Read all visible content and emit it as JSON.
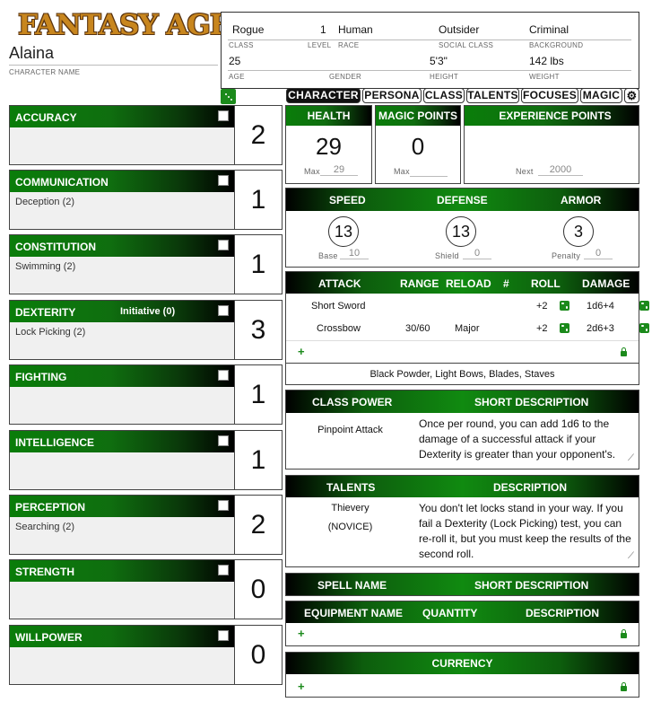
{
  "logo": "FANTASY AGE",
  "character": {
    "name": "Alaina",
    "name_label": "CHARACTER NAME"
  },
  "header": {
    "class": "Rogue",
    "class_label": "CLASS",
    "level": "1",
    "level_label": "LEVEL",
    "race": "Human",
    "race_label": "RACE",
    "social_class": "Outsider",
    "social_class_label": "SOCIAL CLASS",
    "background": "Criminal",
    "background_label": "BACKGROUND",
    "age": "25",
    "age_label": "AGE",
    "gender": "",
    "gender_label": "GENDER",
    "height": "5'3\"",
    "height_label": "HEIGHT",
    "weight": "142 lbs",
    "weight_label": "WEIGHT"
  },
  "tabs": [
    "CHARACTER",
    "PERSONA",
    "CLASS",
    "TALENTS",
    "FOCUSES",
    "MAGIC"
  ],
  "abilities": [
    {
      "name": "ACCURACY",
      "focus": "",
      "value": "2",
      "extra": ""
    },
    {
      "name": "COMMUNICATION",
      "focus": "Deception (2)",
      "value": "1",
      "extra": ""
    },
    {
      "name": "CONSTITUTION",
      "focus": "Swimming (2)",
      "value": "1",
      "extra": ""
    },
    {
      "name": "DEXTERITY",
      "focus": "Lock Picking (2)",
      "value": "3",
      "extra": "Initiative (0)"
    },
    {
      "name": "FIGHTING",
      "focus": "",
      "value": "1",
      "extra": ""
    },
    {
      "name": "INTELLIGENCE",
      "focus": "",
      "value": "1",
      "extra": ""
    },
    {
      "name": "PERCEPTION",
      "focus": "Searching (2)",
      "value": "2",
      "extra": ""
    },
    {
      "name": "STRENGTH",
      "focus": "",
      "value": "0",
      "extra": ""
    },
    {
      "name": "WILLPOWER",
      "focus": "",
      "value": "0",
      "extra": ""
    }
  ],
  "health": {
    "title": "HEALTH",
    "value": "29",
    "max_label": "Max",
    "max": "29"
  },
  "magic": {
    "title": "MAGIC POINTS",
    "value": "0",
    "max_label": "Max",
    "max": ""
  },
  "xp": {
    "title": "EXPERIENCE POINTS",
    "next_label": "Next",
    "next": "2000"
  },
  "defenses": {
    "speed_title": "SPEED",
    "defense_title": "DEFENSE",
    "armor_title": "ARMOR",
    "speed": "13",
    "defense": "13",
    "armor": "3",
    "base_label": "Base",
    "base": "10",
    "shield_label": "Shield",
    "shield": "0",
    "penalty_label": "Penalty",
    "penalty": "0"
  },
  "attacks": {
    "headers": [
      "ATTACK",
      "RANGE",
      "RELOAD",
      "#",
      "ROLL",
      "DAMAGE"
    ],
    "rows": [
      {
        "name": "Short Sword",
        "range": "",
        "reload": "",
        "num": "",
        "roll": "+2",
        "damage": "1d6+4"
      },
      {
        "name": "Crossbow",
        "range": "30/60",
        "reload": "Major",
        "num": "",
        "roll": "+2",
        "damage": "2d6+3"
      }
    ],
    "weapon_groups": "Black Powder, Light Bows, Blades, Staves"
  },
  "class_power": {
    "h1": "CLASS POWER",
    "h2": "SHORT DESCRIPTION",
    "name": "Pinpoint Attack",
    "desc": "Once per round, you can add 1d6 to the damage of a successful attack if your Dexterity is greater than your opponent's."
  },
  "talents": {
    "h1": "TALENTS",
    "h2": "DESCRIPTION",
    "name": "Thievery",
    "level": "(NOVICE)",
    "desc": "You don't let locks stand in your way. If you fail a Dexterity (Lock Picking) test, you can re-roll it, but you must keep the results of the second roll."
  },
  "spells": {
    "h1": "SPELL NAME",
    "h2": "SHORT DESCRIPTION"
  },
  "equipment": {
    "h1": "EQUIPMENT NAME",
    "h2": "QUANTITY",
    "h3": "DESCRIPTION"
  },
  "currency": {
    "title": "CURRENCY"
  },
  "colors": {
    "accent": "#108a10",
    "dark": "#000000"
  }
}
